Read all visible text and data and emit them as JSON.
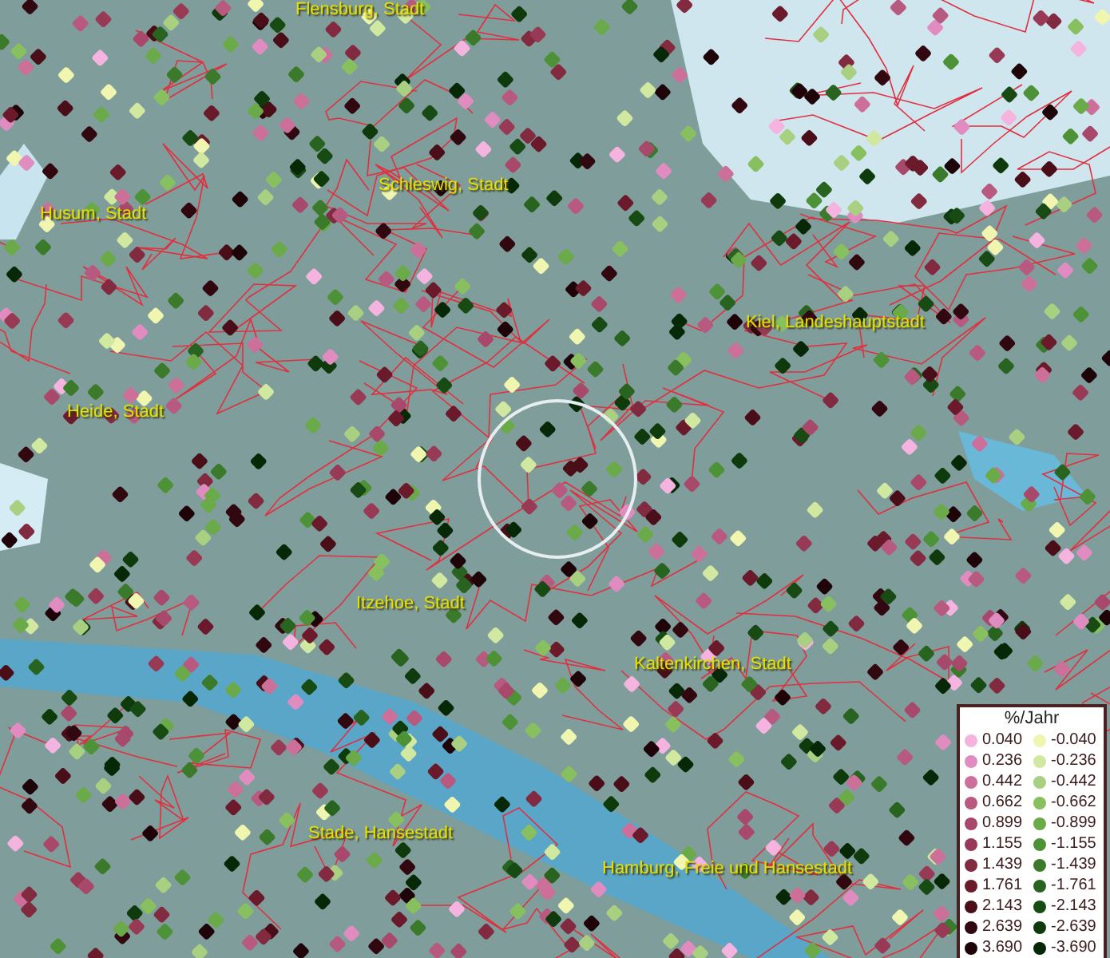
{
  "map": {
    "places": [
      {
        "name": "Flensburg, Stadt"
      },
      {
        "name": "Schleswig, Stadt"
      },
      {
        "name": "Husum, Stadt"
      },
      {
        "name": "Kiel, Landeshauptstadt"
      },
      {
        "name": "Heide, Stadt"
      },
      {
        "name": "Itzehoe, Stadt"
      },
      {
        "name": "Kaltenkirchen, Stadt"
      },
      {
        "name": "Stade, Hansestadt"
      },
      {
        "name": "Hamburg, Freie und Hansestadt"
      }
    ]
  },
  "legend": {
    "title": "%/Jahr",
    "increase": [
      {
        "label": "0.040",
        "color": "#f5b3e0"
      },
      {
        "label": "0.236",
        "color": "#e08cc0"
      },
      {
        "label": "0.442",
        "color": "#cc7099"
      },
      {
        "label": "0.662",
        "color": "#b85a80"
      },
      {
        "label": "0.899",
        "color": "#a8486a"
      },
      {
        "label": "1.155",
        "color": "#983a55"
      },
      {
        "label": "1.439",
        "color": "#822a40"
      },
      {
        "label": "1.761",
        "color": "#6a1a2a"
      },
      {
        "label": "2.143",
        "color": "#4a0e18"
      },
      {
        "label": "2.639",
        "color": "#320810"
      },
      {
        "label": "3.690",
        "color": "#1e0408"
      }
    ],
    "decrease": [
      {
        "label": "-0.040",
        "color": "#f0f5b0"
      },
      {
        "label": "-0.236",
        "color": "#d0e8a0"
      },
      {
        "label": "-0.442",
        "color": "#a8d080"
      },
      {
        "label": "-0.662",
        "color": "#88c060"
      },
      {
        "label": "-0.899",
        "color": "#6aaa48"
      },
      {
        "label": "-1.155",
        "color": "#4e9238"
      },
      {
        "label": "-1.439",
        "color": "#3a7a2a"
      },
      {
        "label": "-1.761",
        "color": "#286420"
      },
      {
        "label": "-2.143",
        "color": "#184a14"
      },
      {
        "label": "-2.639",
        "color": "#0e3a0c"
      },
      {
        "label": "-3.690",
        "color": "#062806"
      }
    ]
  }
}
